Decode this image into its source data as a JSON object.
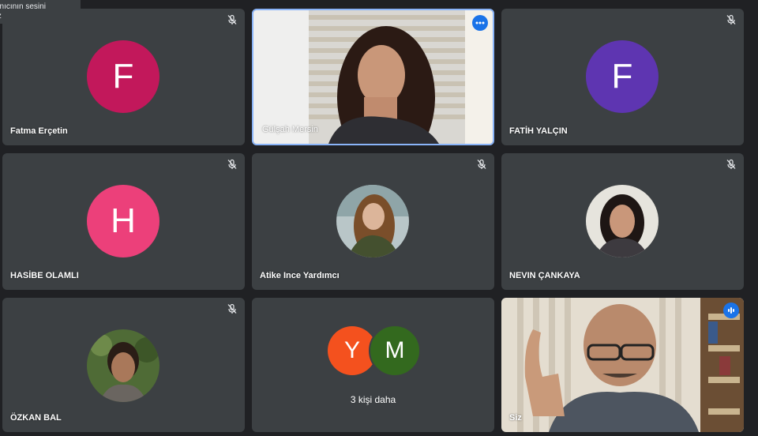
{
  "tooltip": {
    "line1": "anıcının sesini",
    "line2": "ız"
  },
  "participants": [
    {
      "name": "Fatma Erçetin",
      "initial": "F",
      "avatar_color": "#c2185b",
      "muted": true
    },
    {
      "name": "Gülşah Mersin",
      "muted": false,
      "video": true
    },
    {
      "name": "FATİH YALÇIN",
      "initial": "F",
      "avatar_color": "#5e35b1",
      "muted": true
    },
    {
      "name": "HASİBE OLAMLI",
      "initial": "H",
      "avatar_color": "#ec407a",
      "muted": true
    },
    {
      "name": "Atike Ince Yardımcı",
      "muted": true
    },
    {
      "name": "NEVIN ÇANKAYA",
      "muted": true
    },
    {
      "name": "ÖZKAN BAL",
      "muted": true
    },
    {
      "name": "Siz",
      "muted": false,
      "video": true
    }
  ],
  "more": {
    "count_label": "3 kişi daha",
    "avatars": [
      {
        "initial": "Y",
        "color": "#f4511e"
      },
      {
        "initial": "M",
        "color": "#33691e"
      }
    ]
  },
  "colors": {
    "tile_bg": "#3c4043",
    "page_bg": "#202124",
    "accent": "#1a73e8"
  }
}
